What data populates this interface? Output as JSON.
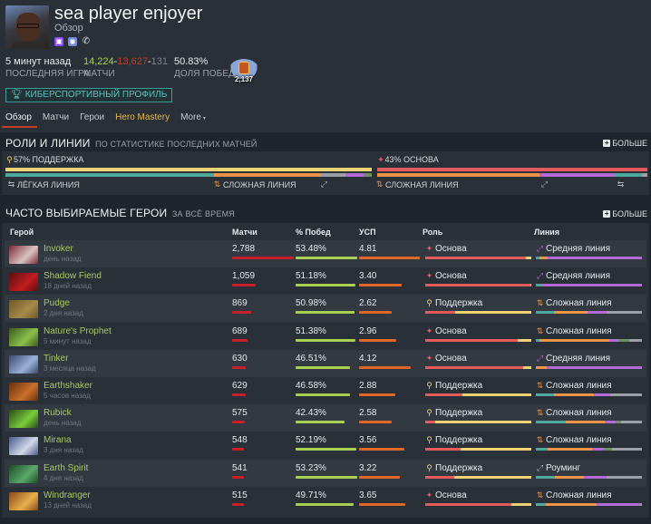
{
  "profile": {
    "name": "sea player enjoyer",
    "subtitle": "Обзор",
    "socials": [
      "twitch-icon",
      "discord-icon",
      "phone-icon"
    ],
    "last_game": {
      "value": "5 минут назад",
      "label": "ПОСЛЕДНЯЯ ИГРА"
    },
    "matches": {
      "wins": "14,224",
      "losses": "13,627",
      "abandons": "131",
      "sep": "-",
      "label": "МАТЧИ"
    },
    "winrate": {
      "value": "50.83%",
      "label": "ДОЛЯ ПОБЕД"
    },
    "rank": "2,137",
    "esports_button": "КИБЕРСПОРТИВНЫЙ ПРОФИЛЬ"
  },
  "tabs": [
    {
      "label": "Обзор",
      "active": true
    },
    {
      "label": "Матчи"
    },
    {
      "label": "Герои"
    },
    {
      "label": "Hero Mastery"
    },
    {
      "label": "More",
      "caret": "▾"
    }
  ],
  "roles_section": {
    "title": "РОЛИ И ЛИНИИ",
    "subtitle": "ПО СТАТИСТИКЕ ПОСЛЕДНИХ МАТЧЕЙ",
    "more": "БОЛЬШЕ",
    "support": {
      "caption": "57% ПОДДЕРЖКА",
      "percent": 57,
      "lanes": [
        {
          "lane": "safe",
          "share": 57,
          "color": "#4fa89d"
        },
        {
          "lane": "off",
          "share": 29,
          "color": "#ee9448"
        },
        {
          "lane": "safe-alt",
          "share": 7,
          "color": "#9aa0a6"
        },
        {
          "lane": "mid",
          "share": 5,
          "color": "#b469d6"
        },
        {
          "lane": "jungle",
          "share": 2,
          "color": "#6f8f6a"
        }
      ],
      "lane_labels": [
        "ЛЁГКАЯ ЛИНИЯ",
        "СЛОЖНАЯ ЛИНИЯ"
      ]
    },
    "core": {
      "caption": "43% ОСНОВА",
      "percent": 43,
      "lanes": [
        {
          "lane": "off",
          "share": 60,
          "color": "#ee9448"
        },
        {
          "lane": "mid",
          "share": 28,
          "color": "#b469d6"
        },
        {
          "lane": "safe",
          "share": 10,
          "color": "#4fa89d"
        },
        {
          "lane": "other",
          "share": 2,
          "color": "#9aa0a6"
        }
      ],
      "lane_labels": [
        "СЛОЖНАЯ ЛИНИЯ"
      ]
    },
    "colors": {
      "support": "#f0d373",
      "core": "#e55a5a"
    }
  },
  "heroes_section": {
    "title": "ЧАСТО ВЫБИРАЕМЫЕ ГЕРОИ",
    "subtitle": "ЗА ВСЁ ВРЕМЯ",
    "more": "БОЛЬШЕ",
    "columns": [
      "Герой",
      "Матчи",
      "% Побед",
      "УСП",
      "Роль",
      "Линия"
    ],
    "rows": [
      {
        "hero": "Invoker",
        "when": "день назад",
        "matches": "2,788",
        "m": 2788,
        "winrate": "53.48%",
        "w": 53.48,
        "kda": "4.81",
        "k": 4.81,
        "role": "Основа",
        "role_type": "core",
        "role_split": [
          95,
          5
        ],
        "lane": "Средняя линия",
        "lane_type": "mid",
        "lane_split": [
          [
            "#4fa89d",
            3
          ],
          [
            "#ee9448",
            8
          ],
          [
            "#b469d6",
            89
          ]
        ],
        "img": [
          "#7a2a3a",
          "#d9c3c0"
        ]
      },
      {
        "hero": "Shadow Fiend",
        "when": "18 дней назад",
        "matches": "1,059",
        "m": 1059,
        "winrate": "51.18%",
        "w": 51.18,
        "kda": "3.40",
        "k": 3.4,
        "role": "Основа",
        "role_type": "core",
        "role_split": [
          99,
          1
        ],
        "lane": "Средняя линия",
        "lane_type": "mid",
        "lane_split": [
          [
            "#4fa89d",
            6
          ],
          [
            "#b469d6",
            94
          ]
        ],
        "img": [
          "#5a0e10",
          "#c21c20"
        ]
      },
      {
        "hero": "Pudge",
        "when": "2 дня назад",
        "matches": "869",
        "m": 869,
        "winrate": "50.98%",
        "w": 50.98,
        "kda": "2.62",
        "k": 2.62,
        "role": "Поддержка",
        "role_type": "sup",
        "role_split": [
          28,
          72
        ],
        "lane": "Сложная линия",
        "lane_type": "off",
        "lane_split": [
          [
            "#4fa89d",
            17
          ],
          [
            "#ee9448",
            32
          ],
          [
            "#b469d6",
            18
          ],
          [
            "#9aa0a6",
            33
          ]
        ],
        "img": [
          "#6d5a2a",
          "#a68a4a"
        ]
      },
      {
        "hero": "Nature's Prophet",
        "when": "5 минут назад",
        "matches": "689",
        "m": 689,
        "winrate": "51.38%",
        "w": 51.38,
        "kda": "2.96",
        "k": 2.96,
        "role": "Основа",
        "role_type": "core",
        "role_split": [
          87,
          13
        ],
        "lane": "Сложная линия",
        "lane_type": "off",
        "lane_split": [
          [
            "#4fa89d",
            3
          ],
          [
            "#ee9448",
            66
          ],
          [
            "#b469d6",
            9
          ],
          [
            "#6f8f6a",
            10
          ],
          [
            "#9aa0a6",
            12
          ]
        ],
        "img": [
          "#3b5a1e",
          "#8ac04a"
        ]
      },
      {
        "hero": "Tinker",
        "when": "3 месяца назад",
        "matches": "630",
        "m": 630,
        "winrate": "46.51%",
        "w": 46.51,
        "kda": "4.12",
        "k": 4.12,
        "role": "Основа",
        "role_type": "core",
        "role_split": [
          92,
          8
        ],
        "lane": "Средняя линия",
        "lane_type": "mid",
        "lane_split": [
          [
            "#ee9448",
            10
          ],
          [
            "#b469d6",
            90
          ]
        ],
        "img": [
          "#3a4a6a",
          "#9ab0d8"
        ]
      },
      {
        "hero": "Earthshaker",
        "when": "5 часов назад",
        "matches": "629",
        "m": 629,
        "winrate": "46.58%",
        "w": 46.58,
        "kda": "2.88",
        "k": 2.88,
        "role": "Поддержка",
        "role_type": "sup",
        "role_split": [
          35,
          65
        ],
        "lane": "Сложная линия",
        "lane_type": "off",
        "lane_split": [
          [
            "#4fa89d",
            17
          ],
          [
            "#ee9448",
            38
          ],
          [
            "#b469d6",
            15
          ],
          [
            "#9aa0a6",
            30
          ]
        ],
        "img": [
          "#6a3010",
          "#c8702a"
        ]
      },
      {
        "hero": "Rubick",
        "when": "день назад",
        "matches": "575",
        "m": 575,
        "winrate": "42.43%",
        "w": 42.43,
        "kda": "2.58",
        "k": 2.58,
        "role": "Поддержка",
        "role_type": "sup",
        "role_split": [
          9,
          91
        ],
        "lane": "Сложная линия",
        "lane_type": "off",
        "lane_split": [
          [
            "#4fa89d",
            28
          ],
          [
            "#ee9448",
            37
          ],
          [
            "#b469d6",
            10
          ],
          [
            "#6f8f6a",
            5
          ],
          [
            "#9aa0a6",
            20
          ]
        ],
        "img": [
          "#2a4a1a",
          "#7acc3a"
        ]
      },
      {
        "hero": "Mirana",
        "when": "3 дня назад",
        "matches": "548",
        "m": 548,
        "winrate": "52.19%",
        "w": 52.19,
        "kda": "3.56",
        "k": 3.56,
        "role": "Поддержка",
        "role_type": "sup",
        "role_split": [
          33,
          67
        ],
        "lane": "Сложная линия",
        "lane_type": "off",
        "lane_split": [
          [
            "#4fa89d",
            11
          ],
          [
            "#ee9448",
            42
          ],
          [
            "#b469d6",
            10
          ],
          [
            "#6f8f6a",
            9
          ],
          [
            "#9aa0a6",
            28
          ]
        ],
        "img": [
          "#4a5a8a",
          "#d0d8e8"
        ]
      },
      {
        "hero": "Earth Spirit",
        "when": "4 дня назад",
        "matches": "541",
        "m": 541,
        "winrate": "53.23%",
        "w": 53.23,
        "kda": "3.22",
        "k": 3.22,
        "role": "Поддержка",
        "role_type": "sup",
        "role_split": [
          27,
          73
        ],
        "lane": "Роуминг",
        "lane_type": "roam",
        "lane_split": [
          [
            "#4fa89d",
            18
          ],
          [
            "#ee9448",
            27
          ],
          [
            "#b469d6",
            22
          ],
          [
            "#9aa0a6",
            33
          ]
        ],
        "img": [
          "#1e4a2a",
          "#5aa86a"
        ]
      },
      {
        "hero": "Windranger",
        "when": "13 дней назад",
        "matches": "515",
        "m": 515,
        "winrate": "49.71%",
        "w": 49.71,
        "kda": "3.65",
        "k": 3.65,
        "role": "Основа",
        "role_type": "core",
        "role_split": [
          81,
          19
        ],
        "lane": "Сложная линия",
        "lane_type": "off",
        "lane_split": [
          [
            "#4fa89d",
            9
          ],
          [
            "#ee9448",
            48
          ],
          [
            "#b469d6",
            41
          ],
          [
            "#9aa0a6",
            2
          ]
        ],
        "img": [
          "#8a4a1a",
          "#e8b04a"
        ]
      }
    ]
  },
  "colors": {
    "win": "#a9cf54",
    "loss": "#c23c2a",
    "matches_bar": "#c8202a",
    "winrate_bar": "#a9cf54",
    "kda_bar": "#e0672a",
    "role_core": "#e55a5a",
    "role_support": "#f0d373"
  }
}
